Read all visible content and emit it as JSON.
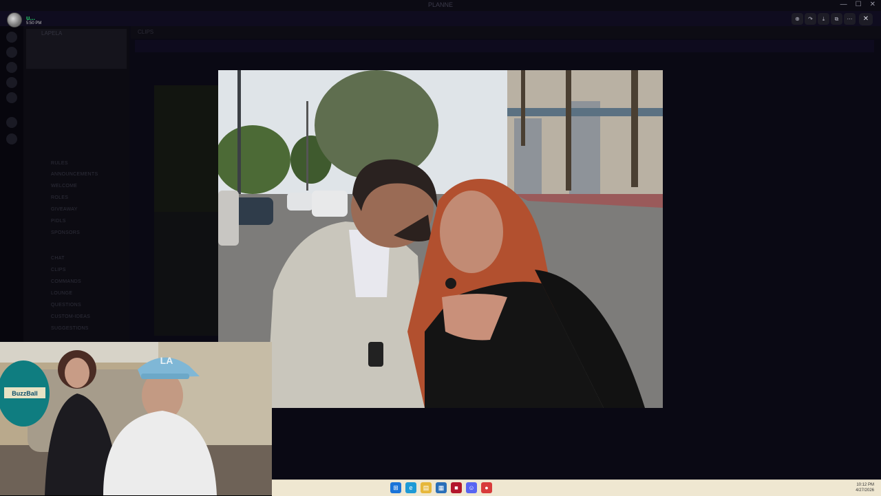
{
  "window": {
    "title": "PLANNE",
    "controls": [
      "—",
      "☐",
      "✕"
    ]
  },
  "user": {
    "name": "u...",
    "time": "5:50 PM"
  },
  "sidebar": {
    "server_name": "LAPELA",
    "channels": [
      "RULES",
      "ANNOUNCEMENTS",
      "WELCOME",
      "ROLES",
      "GIVEAWAY",
      "PIDLS",
      "SPONSORS",
      "CHAT",
      "CLIPS",
      "COMMANDS",
      "LOUNGE",
      "QUESTIONS",
      "CUSTOM-IDEAS",
      "SUGGESTIONS"
    ]
  },
  "chat": {
    "channel_title": "CLIPS"
  },
  "viewer": {
    "buttons": [
      "zoom-in",
      "forward",
      "download",
      "open-external",
      "more"
    ],
    "close_label": "✕"
  },
  "webcam": {
    "hat_text": "LA",
    "jar_text": "BuzzBall"
  },
  "taskbar": {
    "icons": [
      "start",
      "edge",
      "explorer",
      "store",
      "app-red",
      "discord",
      "chrome-like"
    ],
    "time": "10:12 PM",
    "date": "4/27/2026"
  }
}
